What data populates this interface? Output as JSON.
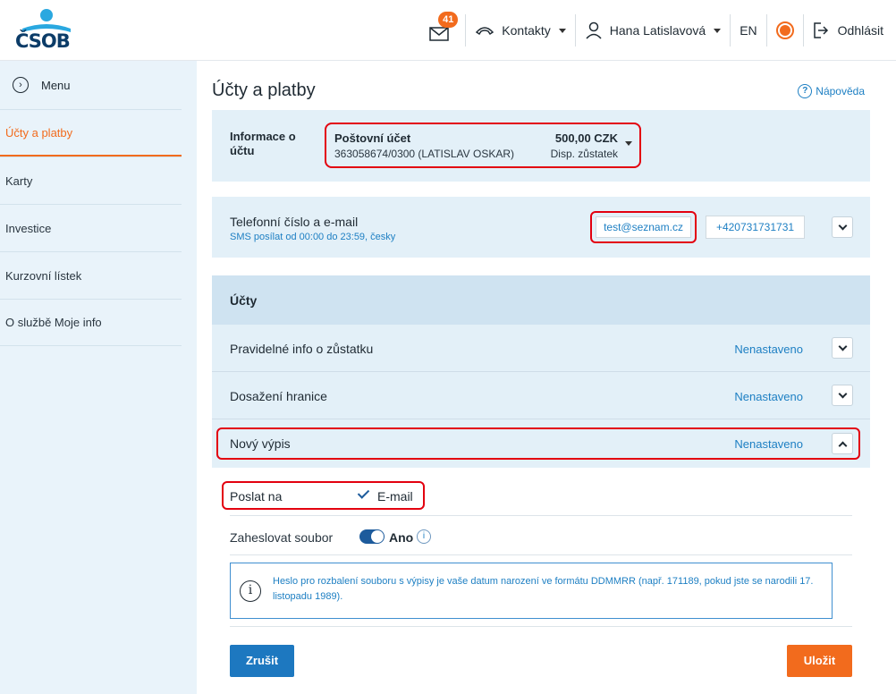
{
  "header": {
    "logo_text": "ČSOB",
    "mail_badge": "41",
    "contacts_label": "Kontakty",
    "user_name": "Hana Latislavová",
    "language": "EN",
    "logout_label": "Odhlásit"
  },
  "sidebar": {
    "menu_label": "Menu",
    "items": [
      {
        "label": "Účty a platby",
        "active": true
      },
      {
        "label": "Karty"
      },
      {
        "label": "Investice"
      },
      {
        "label": "Kurzovní lístek"
      },
      {
        "label": "O službě Moje info"
      }
    ]
  },
  "main": {
    "title": "Účty a platby",
    "help_label": "Nápověda",
    "account_info": {
      "label": "Informace o účtu",
      "account_name": "Poštovní účet",
      "account_number": "363058674/0300 (LATISLAV OSKAR)",
      "balance": "500,00 CZK",
      "balance_type": "Disp. zůstatek"
    },
    "contact": {
      "title": "Telefonní číslo a e-mail",
      "subtitle": "SMS posílat od 00:00 do 23:59, česky",
      "email": "test@seznam.cz",
      "phone": "+420731731731"
    },
    "accounts_section": {
      "title": "Účty",
      "rows": [
        {
          "label": "Pravidelné info o zůstatku",
          "status": "Nenastaveno"
        },
        {
          "label": "Dosažení hranice",
          "status": "Nenastaveno"
        },
        {
          "label": "Nový výpis",
          "status": "Nenastaveno"
        }
      ]
    },
    "statement_settings": {
      "send_to_label": "Poslat na",
      "send_to_value": "E-mail",
      "send_to_checked": true,
      "password_label": "Zaheslovat soubor",
      "password_value": "Ano",
      "password_enabled": true,
      "info_text": "Heslo pro rozbalení souboru s výpisy je vaše datum narození ve formátu DDMMRR (např. 171189, pokud jste se narodili 17. listopadu 1989).",
      "cancel_label": "Zrušit",
      "save_label": "Uložit"
    }
  },
  "colors": {
    "brand_orange": "#f26b1d",
    "brand_blue": "#1d78c0",
    "highlight_red": "#e3000f",
    "panel_bg": "#e3f0f8"
  }
}
